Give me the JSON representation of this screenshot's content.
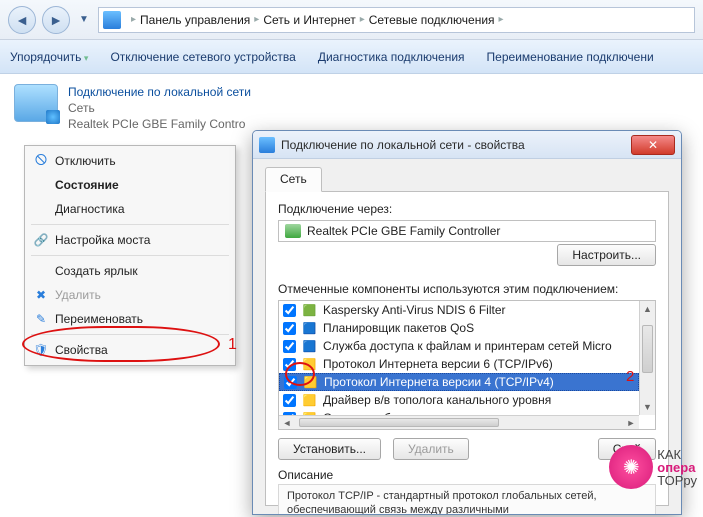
{
  "breadcrumb": {
    "a": "Панель управления",
    "b": "Сеть и Интернет",
    "c": "Сетевые подключения"
  },
  "toolbar": {
    "org": "Упорядочить",
    "disable": "Отключение сетевого устройства",
    "diag": "Диагностика подключения",
    "rename": "Переименование подключени"
  },
  "conn": {
    "title": "Подключение по локальной сети",
    "sub1": "Сеть",
    "sub2_prefix": "Realtek PCIe GBE Family Contro"
  },
  "ctx": {
    "disable": "Отключить",
    "state": "Состояние",
    "diag": "Диагностика",
    "bridge": "Настройка моста",
    "shortcut": "Создать ярлык",
    "delete": "Удалить",
    "rename": "Переименовать",
    "props": "Свойства"
  },
  "ann": {
    "one": "1",
    "two": "2"
  },
  "dlg": {
    "title": "Подключение по локальной сети - свойства",
    "tab": "Сеть",
    "connect_via": "Подключение через:",
    "adapter": "Realtek PCIe GBE Family Controller",
    "configure": "Настроить...",
    "components_label": "Отмеченные компоненты используются этим подключением:",
    "items": [
      "Kaspersky Anti-Virus NDIS 6 Filter",
      "Планировщик пакетов QoS",
      "Служба доступа к файлам и принтерам сетей Micro",
      "Протокол Интернета версии 6 (TCP/IPv6)",
      "Протокол Интернета версии 4 (TCP/IPv4)",
      "Драйвер в/в тополога канального уровня",
      "Ответчик обнаружения топологии канального уров"
    ],
    "install": "Установить...",
    "uninstall": "Удалить",
    "props": "Свой",
    "desc_title": "Описание",
    "desc_text": "Протокол TCP/IP - стандартный протокол глобальных сетей, обеспечивающий связь между различными"
  },
  "wmark": {
    "line1": "КАК",
    "line2": "опера",
    "line3": "ТОРру"
  }
}
